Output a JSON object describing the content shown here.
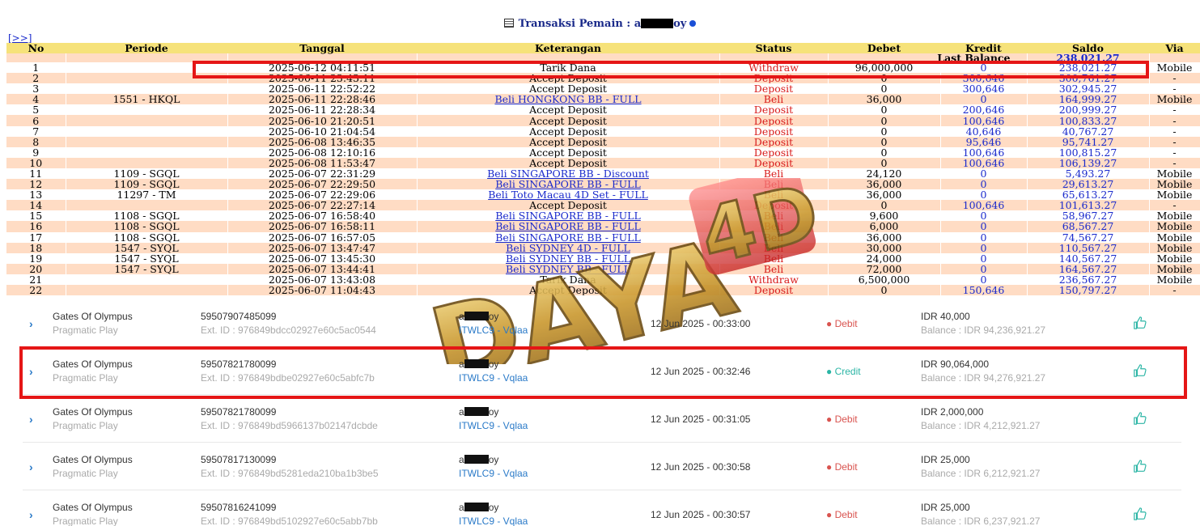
{
  "header": {
    "title_prefix": "Transaksi   Pemain : a",
    "title_suffix": "oy",
    "expand_link": "[>>]"
  },
  "columns": [
    "No",
    "Periode",
    "Tanggal",
    "Keterangan",
    "Status",
    "Debet",
    "Kredit",
    "Saldo",
    "Via"
  ],
  "last_balance": {
    "label": "Last Balance",
    "value": "238,021.27"
  },
  "rows": [
    {
      "no": "1",
      "periode": "",
      "tanggal": "2025-06-12 04:11:51",
      "ket": "Tarik Dana",
      "link": false,
      "status": "Withdraw",
      "debet": "96,000,000",
      "kredit": "0",
      "saldo": "238,021.27",
      "via": "Mobile"
    },
    {
      "no": "2",
      "periode": "",
      "tanggal": "2025-06-11 23:43:11",
      "ket": "Accept Deposit",
      "link": false,
      "status": "Deposit",
      "debet": "0",
      "kredit": "300,646",
      "saldo": "300,761.27",
      "via": "-"
    },
    {
      "no": "3",
      "periode": "",
      "tanggal": "2025-06-11 22:52:22",
      "ket": "Accept Deposit",
      "link": false,
      "status": "Deposit",
      "debet": "0",
      "kredit": "300,646",
      "saldo": "302,945.27",
      "via": "-"
    },
    {
      "no": "4",
      "periode": "1551 - HKQL",
      "tanggal": "2025-06-11 22:28:46",
      "ket": "Beli HONGKONG BB - FULL",
      "link": true,
      "status": "Beli",
      "debet": "36,000",
      "kredit": "0",
      "saldo": "164,999.27",
      "via": "Mobile"
    },
    {
      "no": "5",
      "periode": "",
      "tanggal": "2025-06-11 22:28:34",
      "ket": "Accept Deposit",
      "link": false,
      "status": "Deposit",
      "debet": "0",
      "kredit": "200,646",
      "saldo": "200,999.27",
      "via": "-"
    },
    {
      "no": "6",
      "periode": "",
      "tanggal": "2025-06-10 21:20:51",
      "ket": "Accept Deposit",
      "link": false,
      "status": "Deposit",
      "debet": "0",
      "kredit": "100,646",
      "saldo": "100,833.27",
      "via": "-"
    },
    {
      "no": "7",
      "periode": "",
      "tanggal": "2025-06-10 21:04:54",
      "ket": "Accept Deposit",
      "link": false,
      "status": "Deposit",
      "debet": "0",
      "kredit": "40,646",
      "saldo": "40,767.27",
      "via": "-"
    },
    {
      "no": "8",
      "periode": "",
      "tanggal": "2025-06-08 13:46:35",
      "ket": "Accept Deposit",
      "link": false,
      "status": "Deposit",
      "debet": "0",
      "kredit": "95,646",
      "saldo": "95,741.27",
      "via": "-"
    },
    {
      "no": "9",
      "periode": "",
      "tanggal": "2025-06-08 12:10:16",
      "ket": "Accept Deposit",
      "link": false,
      "status": "Deposit",
      "debet": "0",
      "kredit": "100,646",
      "saldo": "100,815.27",
      "via": "-"
    },
    {
      "no": "10",
      "periode": "",
      "tanggal": "2025-06-08 11:53:47",
      "ket": "Accept Deposit",
      "link": false,
      "status": "Deposit",
      "debet": "0",
      "kredit": "100,646",
      "saldo": "106,139.27",
      "via": "-"
    },
    {
      "no": "11",
      "periode": "1109 - SGQL",
      "tanggal": "2025-06-07 22:31:29",
      "ket": "Beli SINGAPORE BB - Discount",
      "link": true,
      "status": "Beli",
      "debet": "24,120",
      "kredit": "0",
      "saldo": "5,493.27",
      "via": "Mobile"
    },
    {
      "no": "12",
      "periode": "1109 - SGQL",
      "tanggal": "2025-06-07 22:29:50",
      "ket": "Beli SINGAPORE BB - FULL",
      "link": true,
      "status": "Beli",
      "debet": "36,000",
      "kredit": "0",
      "saldo": "29,613.27",
      "via": "Mobile"
    },
    {
      "no": "13",
      "periode": "11297 - TM",
      "tanggal": "2025-06-07 22:29:06",
      "ket": "Beli Toto Macau 4D Set - FULL",
      "link": true,
      "status": "Beli",
      "debet": "36,000",
      "kredit": "0",
      "saldo": "65,613.27",
      "via": "Mobile"
    },
    {
      "no": "14",
      "periode": "",
      "tanggal": "2025-06-07 22:27:14",
      "ket": "Accept Deposit",
      "link": false,
      "status": "Deposit",
      "debet": "0",
      "kredit": "100,646",
      "saldo": "101,613.27",
      "via": "-"
    },
    {
      "no": "15",
      "periode": "1108 - SGQL",
      "tanggal": "2025-06-07 16:58:40",
      "ket": "Beli SINGAPORE BB - FULL",
      "link": true,
      "status": "Beli",
      "debet": "9,600",
      "kredit": "0",
      "saldo": "58,967.27",
      "via": "Mobile"
    },
    {
      "no": "16",
      "periode": "1108 - SGQL",
      "tanggal": "2025-06-07 16:58:11",
      "ket": "Beli SINGAPORE BB - FULL",
      "link": true,
      "status": "Beli",
      "debet": "6,000",
      "kredit": "0",
      "saldo": "68,567.27",
      "via": "Mobile"
    },
    {
      "no": "17",
      "periode": "1108 - SGQL",
      "tanggal": "2025-06-07 16:57:05",
      "ket": "Beli SINGAPORE BB - FULL",
      "link": true,
      "status": "Beli",
      "debet": "36,000",
      "kredit": "0",
      "saldo": "74,567.27",
      "via": "Mobile"
    },
    {
      "no": "18",
      "periode": "1547 - SYQL",
      "tanggal": "2025-06-07 13:47:47",
      "ket": "Beli SYDNEY 4D - FULL",
      "link": true,
      "status": "Beli",
      "debet": "30,000",
      "kredit": "0",
      "saldo": "110,567.27",
      "via": "Mobile"
    },
    {
      "no": "19",
      "periode": "1547 - SYQL",
      "tanggal": "2025-06-07 13:45:30",
      "ket": "Beli SYDNEY BB - FULL",
      "link": true,
      "status": "Beli",
      "debet": "24,000",
      "kredit": "0",
      "saldo": "140,567.27",
      "via": "Mobile"
    },
    {
      "no": "20",
      "periode": "1547 - SYQL",
      "tanggal": "2025-06-07 13:44:41",
      "ket": "Beli SYDNEY BB - FULL",
      "link": true,
      "status": "Beli",
      "debet": "72,000",
      "kredit": "0",
      "saldo": "164,567.27",
      "via": "Mobile"
    },
    {
      "no": "21",
      "periode": "",
      "tanggal": "2025-06-07 13:43:08",
      "ket": "Tarik Dana",
      "link": false,
      "status": "Withdraw",
      "debet": "6,500,000",
      "kredit": "0",
      "saldo": "236,567.27",
      "via": "Mobile"
    },
    {
      "no": "22",
      "periode": "",
      "tanggal": "2025-06-07 11:04:43",
      "ket": "Accept Deposit",
      "link": false,
      "status": "Deposit",
      "debet": "0",
      "kredit": "150,646",
      "saldo": "150,797.27",
      "via": "-"
    }
  ],
  "watermark": "DAYA 4D",
  "game_rows": [
    {
      "game": "Gates Of Olympus",
      "provider": "Pragmatic Play",
      "tid": "59507907485099",
      "ext": "Ext. ID : 976849bdcc02927e60c5ac0544",
      "user_a": "a",
      "user_b": "oy",
      "account": "ITWLC9 - Vqlaa",
      "date": "12 Jun 2025 - 00:33:00",
      "type": "Debit",
      "amount": "IDR 40,000",
      "balance": "Balance : IDR 94,236,921.27"
    },
    {
      "game": "Gates Of Olympus",
      "provider": "Pragmatic Play",
      "tid": "59507821780099",
      "ext": "Ext. ID : 976849bdbe02927e60c5abfc7b",
      "user_a": "a",
      "user_b": "oy",
      "account": "ITWLC9 - Vqlaa",
      "date": "12 Jun 2025 - 00:32:46",
      "type": "Credit",
      "amount": "IDR 90,064,000",
      "balance": "Balance : IDR 94,276,921.27"
    },
    {
      "game": "Gates Of Olympus",
      "provider": "Pragmatic Play",
      "tid": "59507821780099",
      "ext": "Ext. ID : 976849bd5966137b02147dcbde",
      "user_a": "a",
      "user_b": "oy",
      "account": "ITWLC9 - Vqlaa",
      "date": "12 Jun 2025 - 00:31:05",
      "type": "Debit",
      "amount": "IDR 2,000,000",
      "balance": "Balance : IDR 4,212,921.27"
    },
    {
      "game": "Gates Of Olympus",
      "provider": "Pragmatic Play",
      "tid": "59507817130099",
      "ext": "Ext. ID : 976849bd5281eda210ba1b3be5",
      "user_a": "a",
      "user_b": "oy",
      "account": "ITWLC9 - Vqlaa",
      "date": "12 Jun 2025 - 00:30:58",
      "type": "Debit",
      "amount": "IDR 25,000",
      "balance": "Balance : IDR 6,212,921.27"
    },
    {
      "game": "Gates Of Olympus",
      "provider": "Pragmatic Play",
      "tid": "59507816241099",
      "ext": "Ext. ID : 976849bd5102927e60c5abb7bb",
      "user_a": "a",
      "user_b": "oy",
      "account": "ITWLC9 - Vqlaa",
      "date": "12 Jun 2025 - 00:30:57",
      "type": "Debit",
      "amount": "IDR 25,000",
      "balance": "Balance : IDR 6,237,921.27"
    }
  ],
  "colors": {
    "header_bg": "#f6e27a",
    "row_alt": "#ffdcc4",
    "status_red": "#d81b1b",
    "link_blue": "#1a2acc",
    "highlight": "#e51616",
    "debit": "#d9534f",
    "credit": "#2bb5a5"
  }
}
